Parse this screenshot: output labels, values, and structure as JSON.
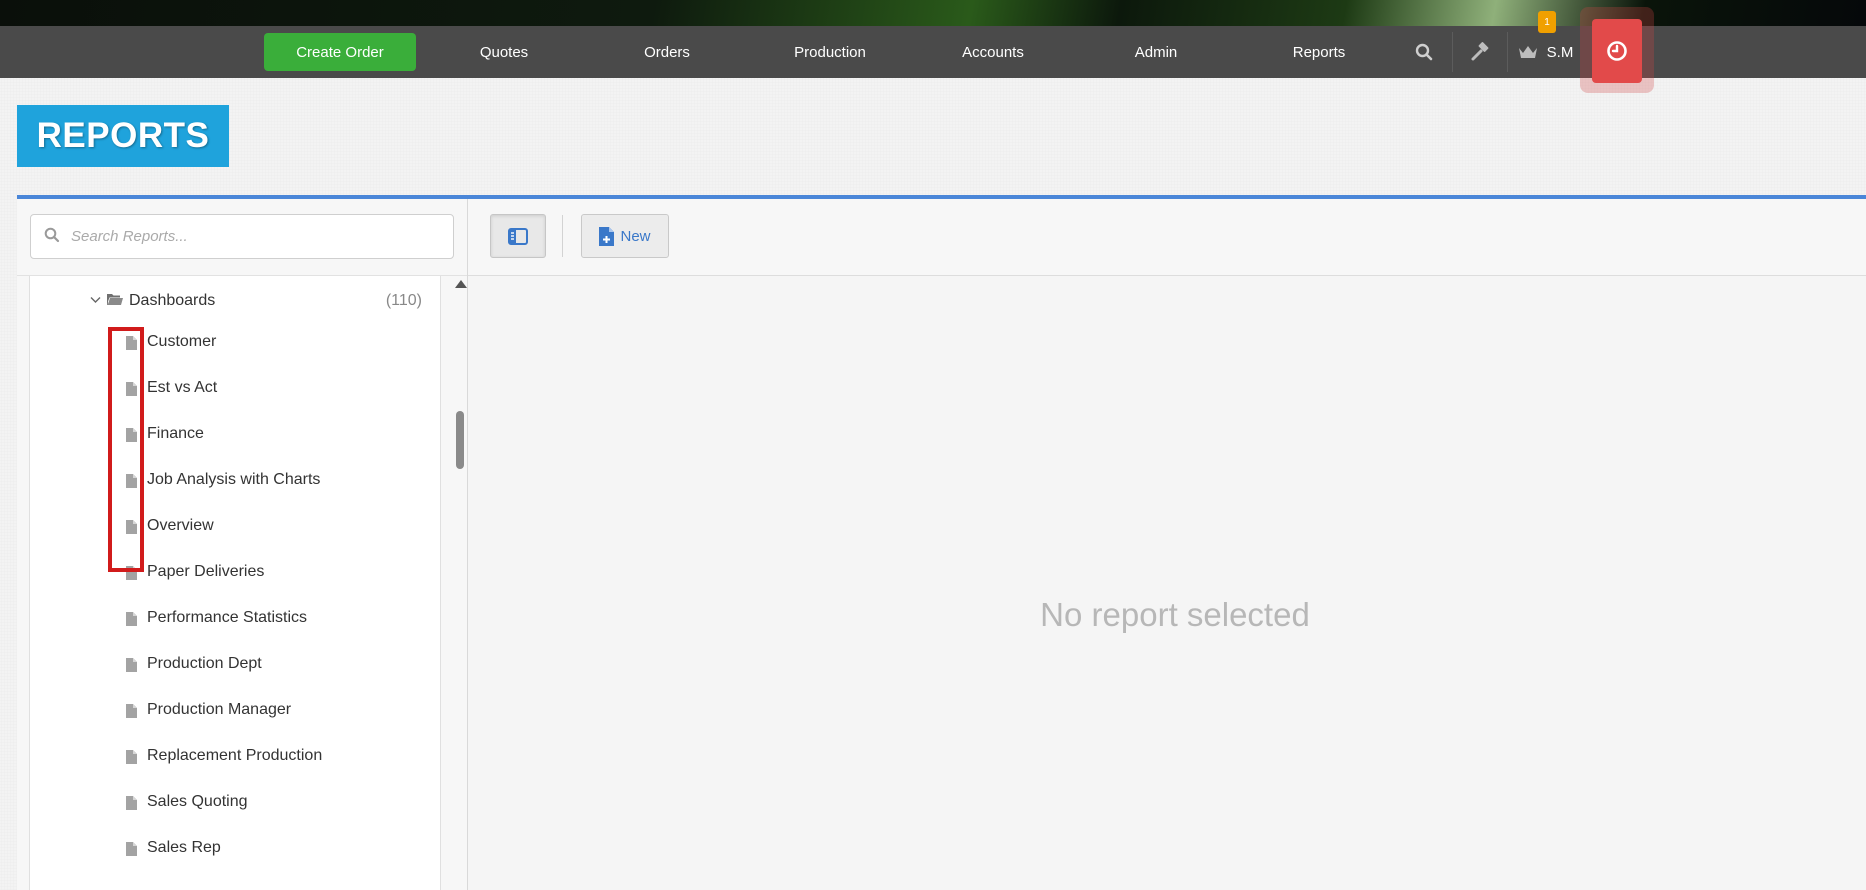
{
  "nav": {
    "create_order": "Create Order",
    "items": [
      "Quotes",
      "Orders",
      "Production",
      "Accounts",
      "Admin",
      "Reports"
    ],
    "user": "S.M",
    "notification_count": "1",
    "icons": {
      "search": "search-icon",
      "tools": "hammer-icon",
      "user": "crown-icon",
      "clock": "clock-icon"
    },
    "colors": {
      "create": "#3aae3a",
      "bar": "#4a4a4a",
      "clock": "#e24a4a",
      "badge": "#f0a000"
    }
  },
  "page": {
    "title": "REPORTS",
    "accent": "#1fa3dc"
  },
  "sidebar": {
    "search_placeholder": "Search Reports...",
    "folder": {
      "label": "Dashboards",
      "count": "(110)"
    },
    "items": [
      "Customer",
      "Est vs Act",
      "Finance",
      "Job Analysis with Charts",
      "Overview",
      "Paper Deliveries",
      "Performance Statistics",
      "Production Dept",
      "Production Manager",
      "Replacement Production",
      "Sales Quoting",
      "Sales Rep"
    ]
  },
  "toolbar": {
    "new_label": "New"
  },
  "main": {
    "empty_message": "No report selected"
  }
}
